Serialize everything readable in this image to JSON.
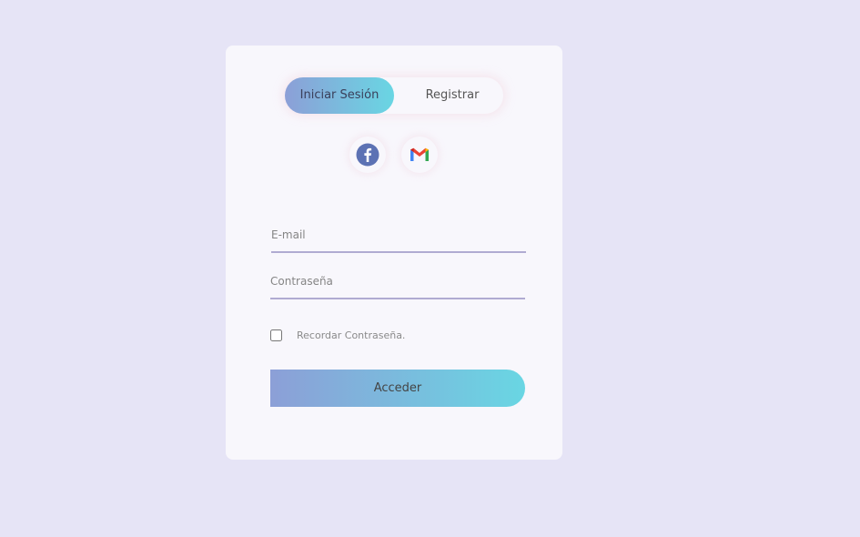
{
  "colors": {
    "page_background": "#e6e4f6",
    "card_background": "#f8f7fc",
    "gradient_start": "#8c9fd7",
    "gradient_end": "#69d6e3",
    "field_underline": "#b0abd2"
  },
  "tabs": {
    "login_label": "Iniciar Sesión",
    "register_label": "Registrar",
    "active": "login"
  },
  "social": {
    "facebook_icon": "facebook-icon",
    "gmail_icon": "gmail-icon"
  },
  "form": {
    "email_placeholder": "E-mail",
    "email_value": "",
    "password_placeholder": "Contraseña",
    "password_value": "",
    "remember_label": "Recordar Contraseña.",
    "remember_checked": false,
    "submit_label": "Acceder"
  }
}
